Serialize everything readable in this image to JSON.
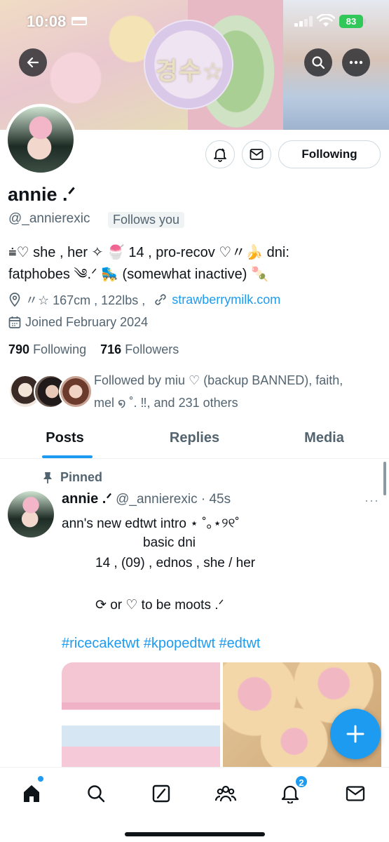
{
  "status_bar": {
    "time": "10:08",
    "battery": "83"
  },
  "banner": {
    "text": "경수☆"
  },
  "profile": {
    "display_name": "annie .ᐟ",
    "handle": "@_annierexic",
    "follows_you": "Follows you",
    "bio_line1": "⩧♡ she , her ✧ 🍧 14 , pro-recov ♡〃🍌 dni:",
    "bio_line2": "fatphobes ༄.ᐟ 🛼 (somewhat inactive) 🍡",
    "location": "〃☆ 167cm , 122lbs ,",
    "website": "strawberrymilk.com",
    "joined": "Joined February 2024",
    "following_count": "790",
    "following_label": "Following",
    "followers_count": "716",
    "followers_label": "Followers",
    "followed_by_line1": "Followed by miu ♡ (backup BANNED), faith,",
    "followed_by_line2": "mel ໑ ˚. ‼︎, and 231 others"
  },
  "actions": {
    "following_label": "Following"
  },
  "tabs": [
    {
      "label": "Posts",
      "active": true
    },
    {
      "label": "Replies",
      "active": false
    },
    {
      "label": "Media",
      "active": false
    }
  ],
  "post": {
    "pinned_label": "Pinned",
    "author": "annie .ᐟ",
    "handle_time": "@_annierexic · 45s",
    "more": "···",
    "lines": [
      "ann's  new  edtwt  intro  ⋆ ˚｡⋆୨୧˚",
      "basic  dni",
      "14 , (09) , ednos , she / her",
      "⟳  or  ♡  to  be  moots .ᐟ"
    ],
    "hashtags": "#ricecaketwt #kpopedtwt #edtwt"
  },
  "bottom_nav": {
    "items": [
      "home-icon",
      "search-icon",
      "compose-icon",
      "communities-icon",
      "notifications-icon",
      "messages-icon"
    ],
    "notifications_badge": "2"
  },
  "colors": {
    "accent": "#1d9bf0",
    "text": "#0f1419",
    "secondary": "#536471",
    "battery": "#32c759"
  }
}
